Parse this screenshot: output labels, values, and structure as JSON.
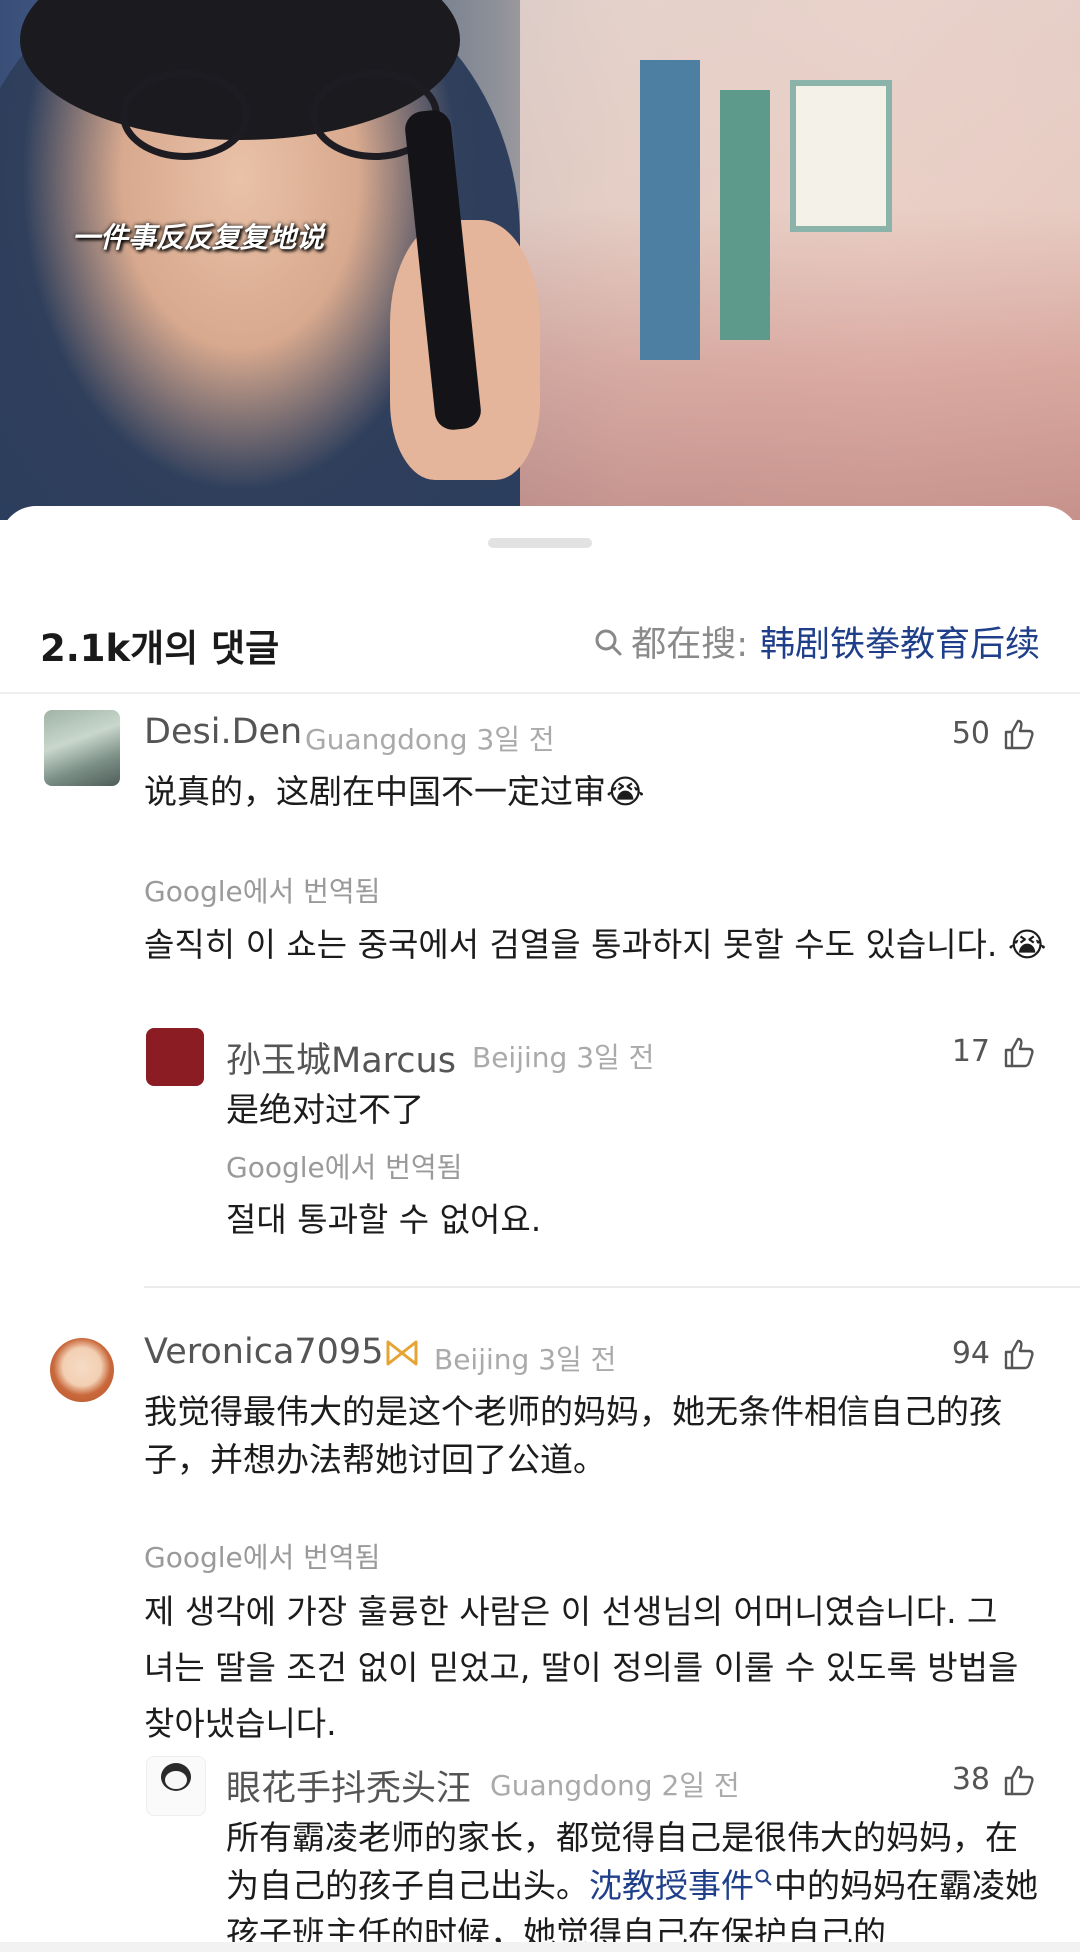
{
  "video": {
    "subtitle": "一件事反反复复地说"
  },
  "header": {
    "comment_count": "2.1k개의 댓글",
    "search_prefix": "都在搜:",
    "search_term": "韩剧铁拳教育后续"
  },
  "translated_label": "Google에서 번역됨",
  "comments": [
    {
      "name": "Desi.Den",
      "location": "Guangdong",
      "time": "3일 전",
      "likes": "50",
      "text": "说真的，这剧在中国不一定过审😭",
      "translation": "솔직히 이 쇼는 중국에서 검열을 통과하지 못할 수도 있습니다. 😭",
      "replies": [
        {
          "name": "孙玉城Marcus",
          "location": "Beijing",
          "time": "3일 전",
          "likes": "17",
          "text": "是绝对过不了",
          "translation": "절대 통과할 수 없어요."
        }
      ]
    },
    {
      "name": "Veronica7095",
      "location": "Beijing",
      "time": "3일 전",
      "likes": "94",
      "text": "我觉得最伟大的是这个老师的妈妈，她无条件相信自己的孩子，并想办法帮她讨回了公道。",
      "translation": "제 생각에 가장 훌륭한 사람은 이 선생님의 어머니였습니다. 그녀는 딸을 조건 없이 믿었고, 딸이 정의를 이룰 수 있도록 방법을 찾아냈습니다.",
      "replies": [
        {
          "name": "眼花手抖秃头汪",
          "location": "Guangdong",
          "time": "2일 전",
          "likes": "38",
          "text_part1": "所有霸凌老师的家长，都觉得自己是很伟大的妈妈，在为自己的孩子自己出头。",
          "link": "沈教授事件",
          "text_part2": "中的妈妈在霸凌她孩子班主任的时候，她觉得自己在保护自己的"
        }
      ]
    }
  ]
}
